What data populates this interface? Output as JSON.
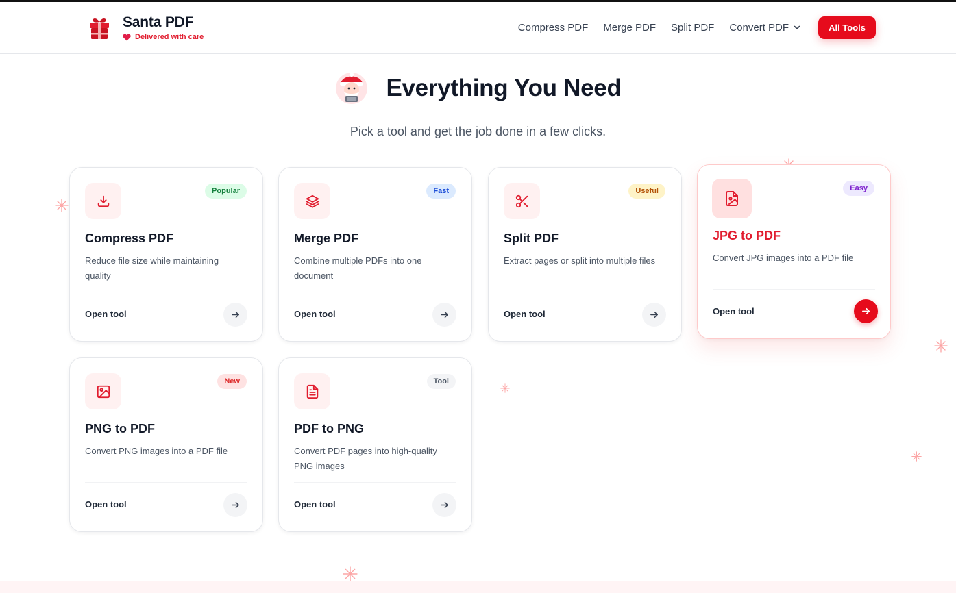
{
  "header": {
    "brand_name": "Santa PDF",
    "tagline": "Delivered with care",
    "nav": [
      {
        "label": "Compress PDF"
      },
      {
        "label": "Merge PDF"
      },
      {
        "label": "Split PDF"
      }
    ],
    "dropdown_label": "Convert PDF",
    "cta_label": "All Tools"
  },
  "hero": {
    "title": "Everything You Need",
    "subtitle": "Pick a tool and get the job done in a few clicks."
  },
  "cards": [
    {
      "title": "Compress PDF",
      "description": "Reduce file size while maintaining quality",
      "badge": "Popular",
      "action": "Open tool",
      "icon": "download-icon"
    },
    {
      "title": "Merge PDF",
      "description": "Combine multiple PDFs into one document",
      "badge": "Fast",
      "action": "Open tool",
      "icon": "layers-icon"
    },
    {
      "title": "Split PDF",
      "description": "Extract pages or split into multiple files",
      "badge": "Useful",
      "action": "Open tool",
      "icon": "scissors-icon"
    },
    {
      "title": "JPG to PDF",
      "description": "Convert JPG images into a PDF file",
      "badge": "Easy",
      "action": "Open tool",
      "icon": "file-image-icon"
    },
    {
      "title": "PNG to PDF",
      "description": "Convert PNG images into a PDF file",
      "badge": "New",
      "action": "Open tool",
      "icon": "image-icon"
    },
    {
      "title": "PDF to PNG",
      "description": "Convert PDF pages into high-quality PNG images",
      "badge": "Tool",
      "action": "Open tool",
      "icon": "file-text-icon"
    }
  ],
  "colors": {
    "accent": "#e60b1c",
    "badge_popular": "#dcfce7",
    "badge_fast": "#dbeafe",
    "badge_useful": "#fef3c7",
    "badge_easy": "#ede9fe",
    "badge_new": "#fee2e2",
    "badge_tool": "#f3f4f6"
  }
}
